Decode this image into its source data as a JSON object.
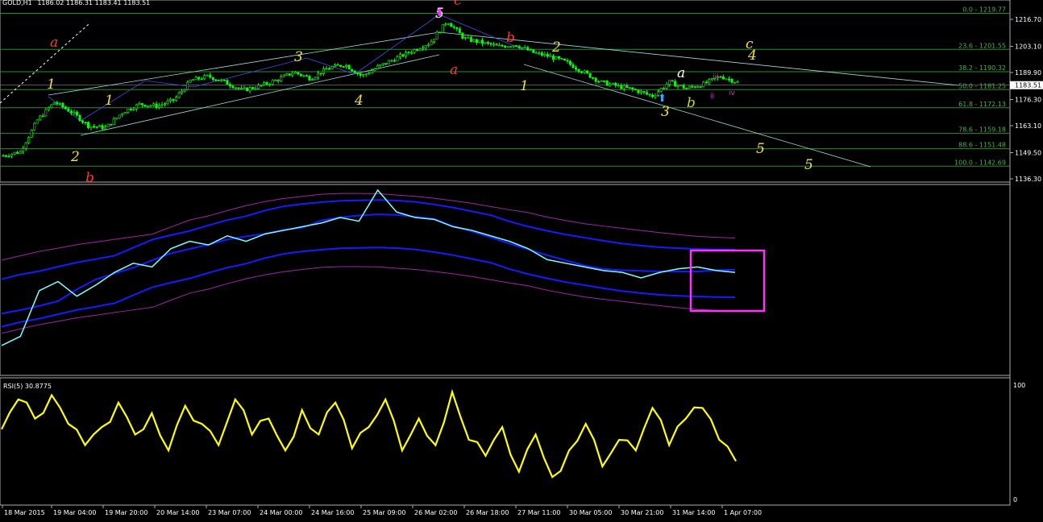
{
  "header": {
    "symbol": "GOLD,H1",
    "ohlc": "1186.02 1186.31 1183.41 1183.51"
  },
  "price_axis": {
    "ticks": [
      "1216.70",
      "1203.10",
      "1189.90",
      "1176.30",
      "1163.10",
      "1149.50",
      "1136.30"
    ],
    "current_price": "1183.51"
  },
  "fib_levels": [
    {
      "label": "0.0 - 1219.77",
      "price": 1219.77
    },
    {
      "label": "23.6 - 1201.55",
      "price": 1201.55
    },
    {
      "label": "38.2 - 1190.32",
      "price": 1190.32
    },
    {
      "label": "50.0 - 1181.25",
      "price": 1181.25
    },
    {
      "label": "61.8 - 1172.13",
      "price": 1172.13
    },
    {
      "label": "78.6 - 1159.18",
      "price": 1159.18
    },
    {
      "label": "88.6 - 1151.48",
      "price": 1151.48
    },
    {
      "label": "100.0 - 1142.69",
      "price": 1142.69
    }
  ],
  "wave_labels": [
    {
      "text": "a",
      "color": "#ff3b1f"
    },
    {
      "text": "1",
      "color": "#f0e040"
    },
    {
      "text": "1",
      "color": "#f0e040"
    },
    {
      "text": "2",
      "color": "#f0e040"
    },
    {
      "text": "b",
      "color": "#ff3b1f"
    },
    {
      "text": "3",
      "color": "#f0e040"
    },
    {
      "text": "4",
      "color": "#f0e040"
    },
    {
      "text": "5",
      "color": "#ffffff"
    },
    {
      "text": "c",
      "color": "#ff3b1f"
    },
    {
      "text": "b",
      "color": "#ff3b1f"
    },
    {
      "text": "a",
      "color": "#ff3b1f"
    },
    {
      "text": "2",
      "color": "#f0e040"
    },
    {
      "text": "1",
      "color": "#f0e040"
    },
    {
      "text": "3",
      "color": "#f0e040"
    },
    {
      "text": "a",
      "color": "#ffffff"
    },
    {
      "text": "b",
      "color": "#c8d040"
    },
    {
      "text": "c",
      "color": "#f0e040"
    },
    {
      "text": "4",
      "color": "#f0e040"
    },
    {
      "text": "5",
      "color": "#f0e040"
    },
    {
      "text": "5",
      "color": "#f0e040"
    },
    {
      "text": "iii",
      "color": "#cc33cc"
    },
    {
      "text": "ii",
      "color": "#cc33cc"
    },
    {
      "text": "iv",
      "color": "#cc33cc"
    }
  ],
  "rsi_panel": {
    "label": "RSI(5) 30.8775",
    "ticks": [
      "100",
      "0"
    ]
  },
  "time_axis": [
    "18 Mar 2015",
    "19 Mar 04:00",
    "19 Mar 20:00",
    "20 Mar 14:00",
    "23 Mar 07:00",
    "24 Mar 00:00",
    "24 Mar 16:00",
    "25 Mar 09:00",
    "26 Mar 02:00",
    "26 Mar 18:00",
    "27 Mar 11:00",
    "30 Mar 05:00",
    "30 Mar 21:00",
    "31 Mar 14:00",
    "1 Apr 07:00"
  ],
  "colors": {
    "background": "#000000",
    "candles": "#00ff00",
    "grid_fib": "#2e8b2e",
    "bollinger": "#1a1aff",
    "price_line": "#7fffff",
    "envelope": "#8b1a8b",
    "rsi": "#ffff00",
    "highlight_box": "#ff33ff"
  },
  "chart_data": [
    {
      "type": "candlestick",
      "title": "GOLD,H1",
      "ylim": [
        1136.3,
        1222
      ],
      "price_path": [
        1148,
        1150,
        1166,
        1175,
        1170,
        1163,
        1162,
        1170,
        1174,
        1173,
        1176,
        1186,
        1188,
        1185,
        1181,
        1183,
        1186,
        1190,
        1187,
        1192,
        1194,
        1188,
        1193,
        1197,
        1201,
        1205,
        1216,
        1207,
        1205,
        1203,
        1204,
        1200,
        1198,
        1195,
        1190,
        1185,
        1183,
        1181,
        1178,
        1185,
        1182,
        1184,
        1188,
        1185
      ]
    },
    {
      "type": "line",
      "title": "",
      "series": [
        {
          "values": [
            15,
            20,
            45,
            50,
            42,
            48,
            55,
            60,
            58,
            68,
            72,
            70,
            75,
            72,
            76,
            78,
            80,
            82,
            85,
            83,
            100,
            88,
            85,
            84,
            80,
            78,
            75,
            72,
            68,
            62,
            60,
            58,
            56,
            55,
            52,
            55,
            57,
            58,
            56,
            55
          ]
        }
      ]
    },
    {
      "type": "line",
      "title": "",
      "ylim": [
        0,
        100
      ],
      "series": [
        {
          "values": [
            60,
            88,
            70,
            92,
            65,
            45,
            62,
            85,
            55,
            75,
            40,
            82,
            65,
            45,
            88,
            55,
            70,
            40,
            78,
            55,
            85,
            42,
            62,
            88,
            40,
            70,
            45,
            95,
            50,
            35,
            62,
            20,
            55,
            15,
            40,
            65,
            25,
            50,
            40,
            80,
            45,
            70,
            80,
            50,
            30
          ]
        }
      ]
    }
  ]
}
